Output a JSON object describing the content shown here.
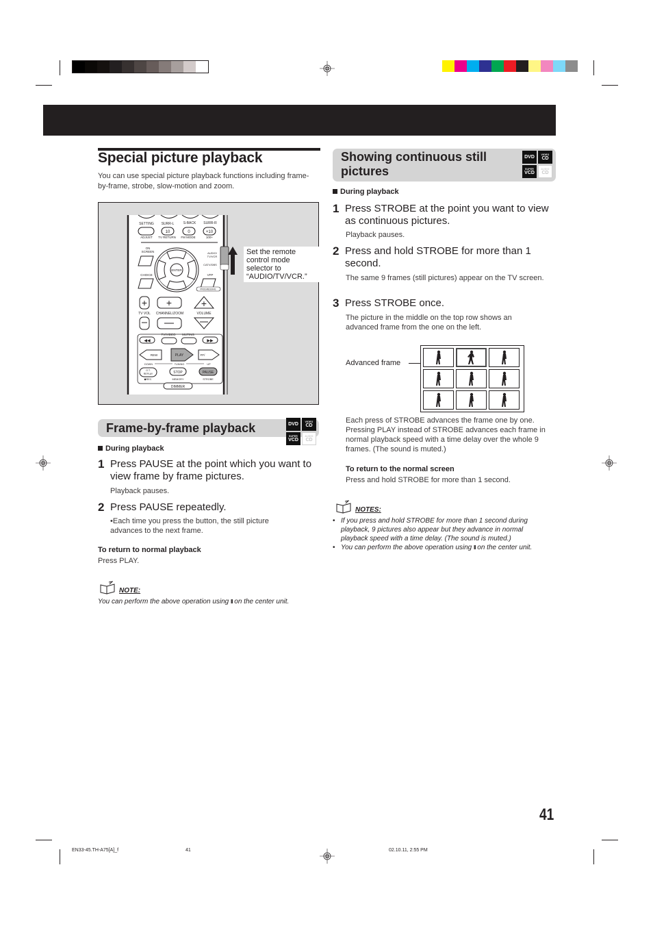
{
  "print_marks": {
    "gray_swatches": [
      "#000000",
      "#0b0907",
      "#15110f",
      "#231f20",
      "#373130",
      "#4e4644",
      "#675c5a",
      "#857b79",
      "#a79f9d",
      "#d3cbca",
      "#ffffff"
    ],
    "color_swatches": [
      "#fff200",
      "#ec008c",
      "#00aeef",
      "#2e3192",
      "#00a651",
      "#ed1c24",
      "#231f20",
      "#fff685",
      "#f287bf",
      "#7dd8f8",
      "#8c8c8c"
    ]
  },
  "left": {
    "title": "Special picture playback",
    "intro": "You can use special picture playback functions including frame-by-frame, strobe, slow-motion and zoom.",
    "remote": {
      "callout": "Set the remote control mode selector to “AUDIO/TV/VCR.”",
      "row1_labels": [
        "SETTING",
        "SURR-L",
        "S-BACK",
        "SURR-R"
      ],
      "row2_buttons": [
        "",
        "10",
        "0",
        "+10"
      ],
      "row2_labels": [
        "ADJUST",
        "TV RETURN",
        "FM MODE",
        "100+"
      ],
      "on_screen": "ON SCREEN",
      "enter": "ENTER",
      "choice": "CHOICE",
      "vfp": "VFP",
      "progressive": "PROGRESSIVE",
      "selector_top": "AUDIO/ TV/VCR",
      "selector_bottom": "CATV/DBS",
      "tv_vol": "TV VOL",
      "channel_zoom": "CHANNEL/ZOOM",
      "volume": "VOLUME",
      "tv_video": "TV/VIDEO",
      "muting": "MUTING",
      "rew": "REW",
      "play": "PLAY",
      "ff": "FF/",
      "down": "DOWN",
      "tuning": "TUNING",
      "up": "UP",
      "ot_replay": "O.T. REPLAY",
      "rec": "◆REC",
      "stop": "STOP",
      "memory": "MEMORY",
      "pause": "PAUSE",
      "strobe": "STROBE",
      "dimmer": "DIMMER"
    },
    "section": {
      "title": "Frame-by-frame playback",
      "badges": [
        {
          "top": "",
          "main": "DVD",
          "enabled": true
        },
        {
          "top": "VIDEO",
          "main": "CD",
          "enabled": true
        },
        {
          "top": "SUPER",
          "main": "VCD",
          "enabled": true
        },
        {
          "top": "AUDIO",
          "main": "CD",
          "enabled": false
        }
      ],
      "subheading": "During playback",
      "steps": [
        {
          "num": "1",
          "text": "Press PAUSE at the point which you want to view frame by frame pictures.",
          "detail": "Playback pauses."
        },
        {
          "num": "2",
          "text": "Press PAUSE repeatedly.",
          "detail": "•Each time you press the button, the still picture advances to the next frame."
        }
      ],
      "return_heading": "To return to normal playback",
      "return_text": "Press PLAY.",
      "note_label": "NOTE:",
      "note_text_before": "You can perform the above operation using",
      "note_glyph": "II",
      "note_text_after": "on the center unit."
    }
  },
  "right": {
    "section": {
      "title": "Showing continuous still pictures",
      "badges": [
        {
          "top": "",
          "main": "DVD",
          "enabled": true
        },
        {
          "top": "VIDEO",
          "main": "CD",
          "enabled": true
        },
        {
          "top": "SUPER",
          "main": "VCD",
          "enabled": true
        },
        {
          "top": "AUDIO",
          "main": "CD",
          "enabled": false
        }
      ],
      "subheading": "During playback",
      "steps": [
        {
          "num": "1",
          "text": "Press STROBE at the point you want to view as continuous pictures.",
          "detail": "Playback pauses."
        },
        {
          "num": "2",
          "text": "Press and hold STROBE for more than 1 second.",
          "detail": "The same 9 frames (still pictures) appear on the TV screen."
        },
        {
          "num": "3",
          "text": "Press STROBE once.",
          "detail": "The picture in the middle on the top row shows an advanced frame from the one on the left."
        }
      ],
      "figure_label": "Advanced frame",
      "frame_count": 9,
      "advanced_frame_index": 1,
      "explanation": "Each press of STROBE advances the frame one by one. Pressing PLAY instead of STROBE advances each frame in normal playback speed with a time delay over the whole 9 frames. (The sound is muted.)",
      "return_heading": "To return to the normal screen",
      "return_text": "Press and hold STROBE for more than 1 second.",
      "notes_label": "NOTES:",
      "notes": [
        "If you press and hold STROBE for more than 1 second during playback, 9 pictures also appear but they advance in normal playback speed with a time delay. (The sound is muted.)",
        "You can perform the above operation using"
      ],
      "note2_glyph": "II",
      "note2_after": "on the center unit."
    }
  },
  "page_number": "41",
  "footer": {
    "file": "EN33-45.TH-A75[A]_f",
    "page": "41",
    "timestamp": "02.10.11, 2:55 PM"
  }
}
